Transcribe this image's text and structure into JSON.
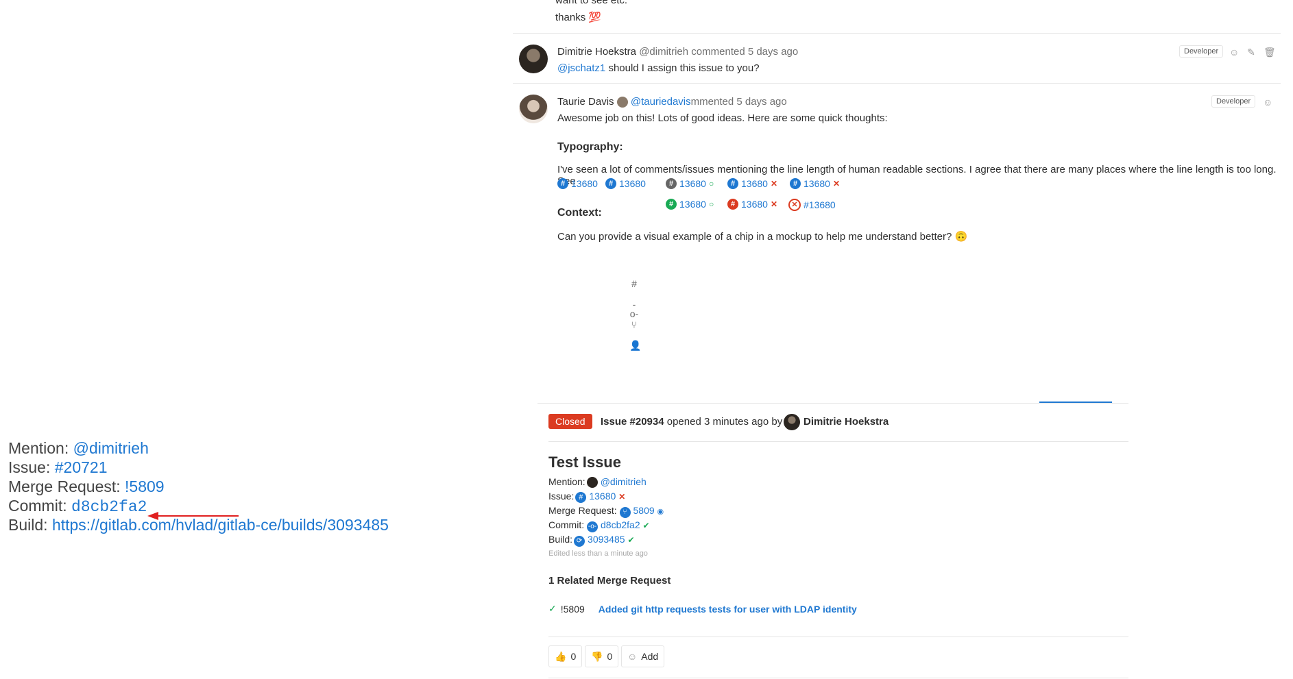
{
  "comments": {
    "prev_text_1": "want to see etc.",
    "prev_text_2": "thanks",
    "prev_emoji": "💯",
    "c1": {
      "author": "Dimitrie Hoekstra",
      "handle": "@dimitrieh",
      "action": "commented 5 days ago",
      "mention": "@jschatz1",
      "body": "should I assign this issue to you?",
      "role": "Developer"
    },
    "c2": {
      "author": "Taurie Davis",
      "handle": "@tauriedavis",
      "action": "mmented 5 days ago",
      "role": "Developer",
      "intro": "Awesome job on this! Lots of good ideas. Here are some quick thoughts:",
      "typography_heading": "Typography:",
      "typography_body": "I've seen a lot of comments/issues mentioning the line length of human readable sections. I agree that there are many places where the line length is too long. See",
      "context_heading": "Context:",
      "context_body": "Can you provide a visual example of a chip in a mockup to help me understand better?",
      "context_emoji": "🙃"
    }
  },
  "chips_row1": [
    "13680",
    "13680",
    "13680",
    "13680",
    "13680"
  ],
  "chips_row2": [
    "13680",
    "13680",
    "#13680"
  ],
  "icon_column": [
    "hash-icon",
    "commit-icon",
    "merge-request-icon",
    "user-icon"
  ],
  "left_list": {
    "mention_label": "Mention:",
    "mention_value": "@dimitrieh",
    "issue_label": "Issue:",
    "issue_value": "#20721",
    "mr_label": "Merge Request:",
    "mr_value": "!5809",
    "commit_label": "Commit:",
    "commit_value": "d8cb2fa2",
    "build_label": "Build:",
    "build_value": "https://gitlab.com/hvlad/gitlab-ce/builds/3093485"
  },
  "issue": {
    "status": "Closed",
    "number": "Issue #20934",
    "opened": "opened 3 minutes ago by",
    "author": "Dimitrie Hoekstra",
    "title": "Test Issue",
    "mention_label": "Mention:",
    "mention_value": "@dimitrieh",
    "issue_label": "Issue:",
    "issue_value": "13680",
    "mr_label": "Merge Request:",
    "mr_value": "5809",
    "commit_label": "Commit:",
    "commit_value": "d8cb2fa2",
    "build_label": "Build:",
    "build_value": "3093485",
    "edited": "Edited less than a minute ago",
    "related_heading": "1 Related Merge Request",
    "related_id": "!5809",
    "related_title": "Added git http requests tests for user with LDAP identity"
  },
  "awards": {
    "thumbs_up": "0",
    "thumbs_down": "0",
    "add_label": "Add"
  },
  "colors": {
    "link": "#1f78d1",
    "closed": "#db3b21",
    "success": "#1aaa55"
  }
}
